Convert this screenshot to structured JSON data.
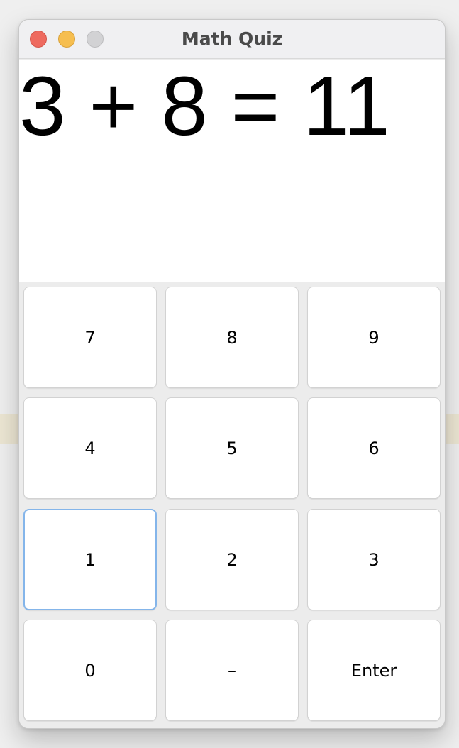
{
  "window": {
    "title": "Math Quiz"
  },
  "display": {
    "equation": "3 + 8 = 11"
  },
  "keypad": {
    "keys": [
      "7",
      "8",
      "9",
      "4",
      "5",
      "6",
      "1",
      "2",
      "3",
      "0",
      "–",
      "Enter"
    ],
    "focused_key": "1"
  },
  "colors": {
    "focus_ring": "#84b5ea",
    "close": "#ee6a5f",
    "minimize": "#f6be4f",
    "maximize": "#d2d2d4"
  }
}
